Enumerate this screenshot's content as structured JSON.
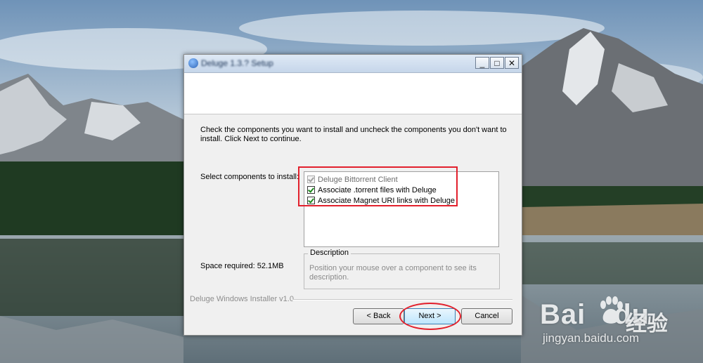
{
  "window": {
    "title": "Deluge 1.3.? Setup",
    "minimize_glyph": "_",
    "maximize_glyph": "□",
    "close_glyph": "✕"
  },
  "page": {
    "intro": "Check the components you want to install and uncheck the components you don't want to install. Click Next to continue.",
    "select_label": "Select components to install:",
    "space_required": "Space required: 52.1MB",
    "components": [
      {
        "label": "Deluge Bittorrent Client",
        "checked": true,
        "disabled": true
      },
      {
        "label": "Associate .torrent files with Deluge",
        "checked": true,
        "disabled": false
      },
      {
        "label": "Associate Magnet URI links with Deluge",
        "checked": true,
        "disabled": false
      }
    ],
    "description_title": "Description",
    "description_text": "Position your mouse over a component to see its description.",
    "installer_name": "Deluge Windows Installer v1.0"
  },
  "buttons": {
    "back": "< Back",
    "next": "Next >",
    "cancel": "Cancel"
  },
  "watermark": {
    "brand": "Bai du",
    "brand_left": "Bai",
    "brand_right": "du",
    "chinese": "经验",
    "url": "jingyan.baidu.com"
  },
  "icons": {
    "title_icon": "deluge-icon",
    "paw": "baidu-paw-icon"
  },
  "colors": {
    "annotation_red": "#e2202c",
    "check_green": "#1d8a1d"
  }
}
